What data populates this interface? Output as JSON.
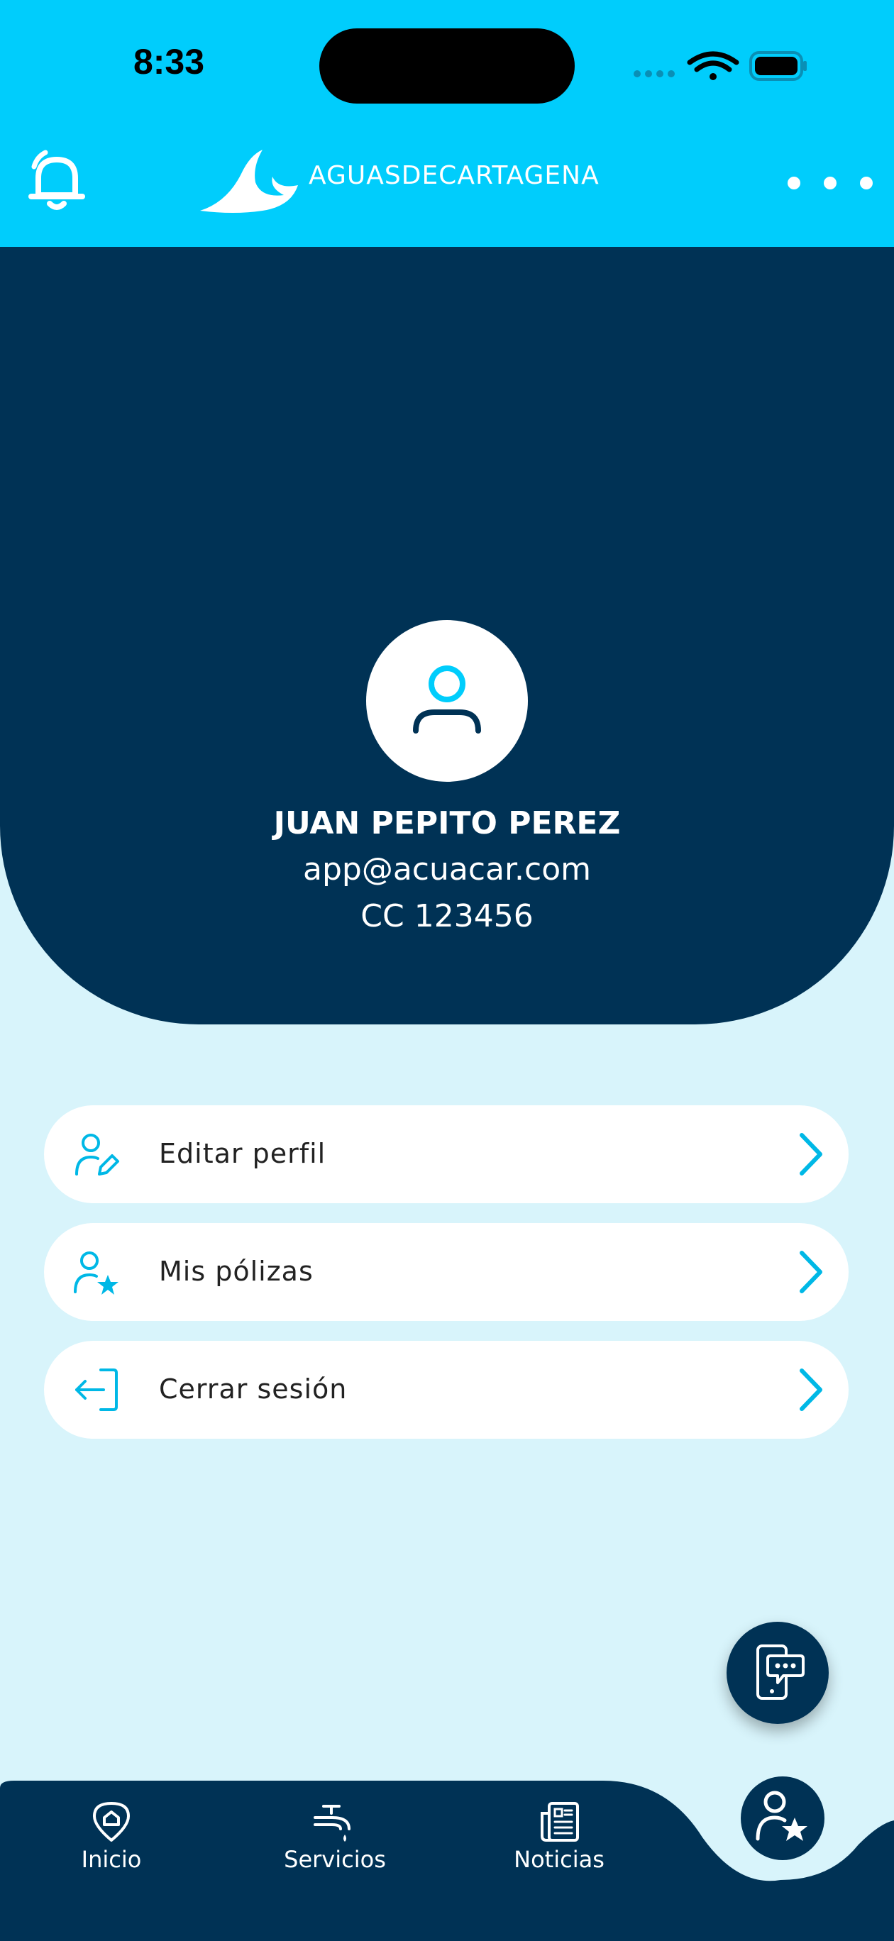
{
  "status_bar": {
    "time": "8:33"
  },
  "header": {
    "brand": "AguasdeCartagena",
    "bell_icon": "bell-icon",
    "more_icon": "more-horizontal-icon"
  },
  "profile": {
    "name": "JUAN PEPITO PEREZ",
    "email": "app@acuacar.com",
    "document": "CC 123456"
  },
  "menu": {
    "items": [
      {
        "label": "Editar perfil",
        "icon": "user-edit-icon"
      },
      {
        "label": "Mis pólizas",
        "icon": "user-star-icon"
      },
      {
        "label": "Cerrar sesión",
        "icon": "logout-icon"
      }
    ]
  },
  "fab": {
    "icon": "phone-chat-icon"
  },
  "bottom_nav": {
    "items": [
      {
        "label": "Inicio",
        "icon": "home-pin-icon"
      },
      {
        "label": "Servicios",
        "icon": "faucet-icon"
      },
      {
        "label": "Noticias",
        "icon": "newspaper-icon"
      }
    ],
    "active_icon": "user-star-icon"
  },
  "colors": {
    "accent": "#00cdfc",
    "navy": "#003255",
    "background": "#d8f4fb"
  }
}
